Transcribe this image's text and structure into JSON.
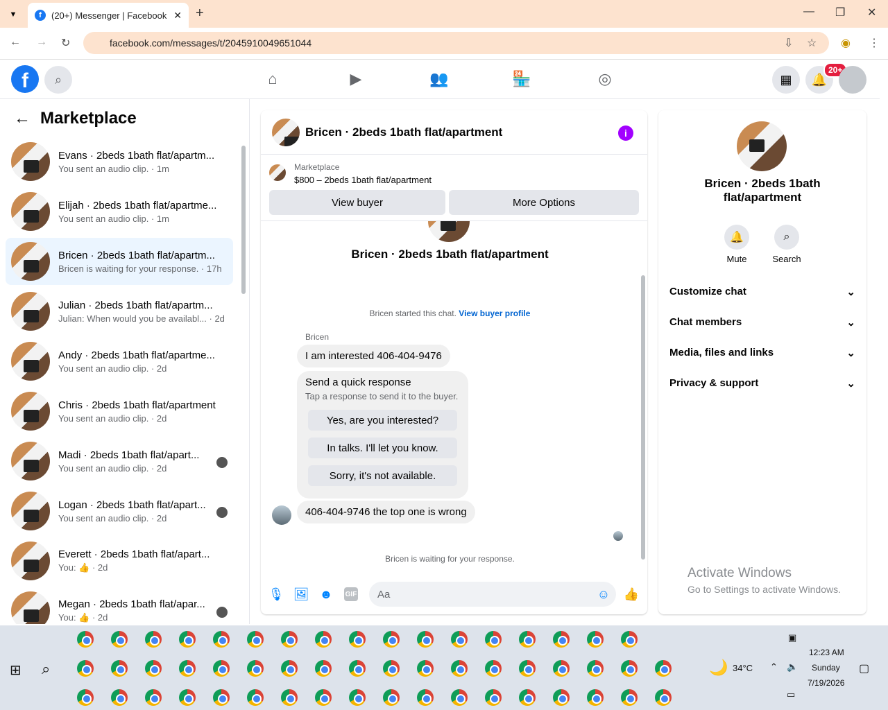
{
  "browser": {
    "tab_title": "(20+) Messenger | Facebook",
    "url": "facebook.com/messages/t/2045910049651044",
    "new_tab": "+",
    "close_tab": "✕"
  },
  "fb_header": {
    "notif_badge": "20+"
  },
  "left": {
    "title": "Marketplace",
    "conversations": [
      {
        "name": "Evans · 2beds 1bath flat/apartm...",
        "preview": "You sent an audio clip. · 1m"
      },
      {
        "name": "Elijah · 2beds 1bath flat/apartme...",
        "preview": "You sent an audio clip. · 1m"
      },
      {
        "name": "Bricen · 2beds 1bath flat/apartm...",
        "preview": "Bricen is waiting for your response. · 17h"
      },
      {
        "name": "Julian · 2beds 1bath flat/apartm...",
        "preview": "Julian: When would you be availabl... · 2d"
      },
      {
        "name": "Andy · 2beds 1bath flat/apartme...",
        "preview": "You sent an audio clip. · 2d"
      },
      {
        "name": "Chris · 2beds 1bath flat/apartment",
        "preview": "You sent an audio clip. · 2d"
      },
      {
        "name": "Madi · 2beds 1bath flat/apart...",
        "preview": "You sent an audio clip. · 2d"
      },
      {
        "name": "Logan · 2beds 1bath flat/apart...",
        "preview": "You sent an audio clip. · 2d"
      },
      {
        "name": "Everett · 2beds 1bath flat/apart...",
        "preview": "You: 👍 · 2d"
      },
      {
        "name": "Megan · 2beds 1bath flat/apar...",
        "preview": "You: 👍 · 2d"
      }
    ]
  },
  "chat": {
    "title": "Bricen · 2beds 1bath flat/apartment",
    "marketplace_label": "Marketplace",
    "listing": "$800 – 2beds 1bath flat/apartment",
    "view_buyer": "View buyer",
    "more_options": "More Options",
    "header_name": "Bricen · 2beds 1bath flat/apartment",
    "started": "Bricen started this chat.",
    "view_profile": "View buyer profile",
    "sender": "Bricen",
    "msg1": "I am interested 406-404-9476",
    "qr_title": "Send a quick response",
    "qr_sub": "Tap a response to send it to the buyer.",
    "qr_options": [
      "Yes, are you interested?",
      "In talks. I'll let you know.",
      "Sorry, it's not available."
    ],
    "msg2": "406-404-9746 the top one is wrong",
    "waiting": "Bricen is waiting for your response.",
    "input_placeholder": "Aa"
  },
  "details": {
    "name": "Bricen · 2beds 1bath flat/apartment",
    "mute": "Mute",
    "search": "Search",
    "sections": [
      "Customize chat",
      "Chat members",
      "Media, files and links",
      "Privacy & support"
    ]
  },
  "watermark": {
    "line1": "Activate Windows",
    "line2": "Go to Settings to activate Windows."
  },
  "taskbar": {
    "weather": "34°C",
    "time": "12:23 AM",
    "day": "Sunday",
    "date": "7/19/2026"
  }
}
